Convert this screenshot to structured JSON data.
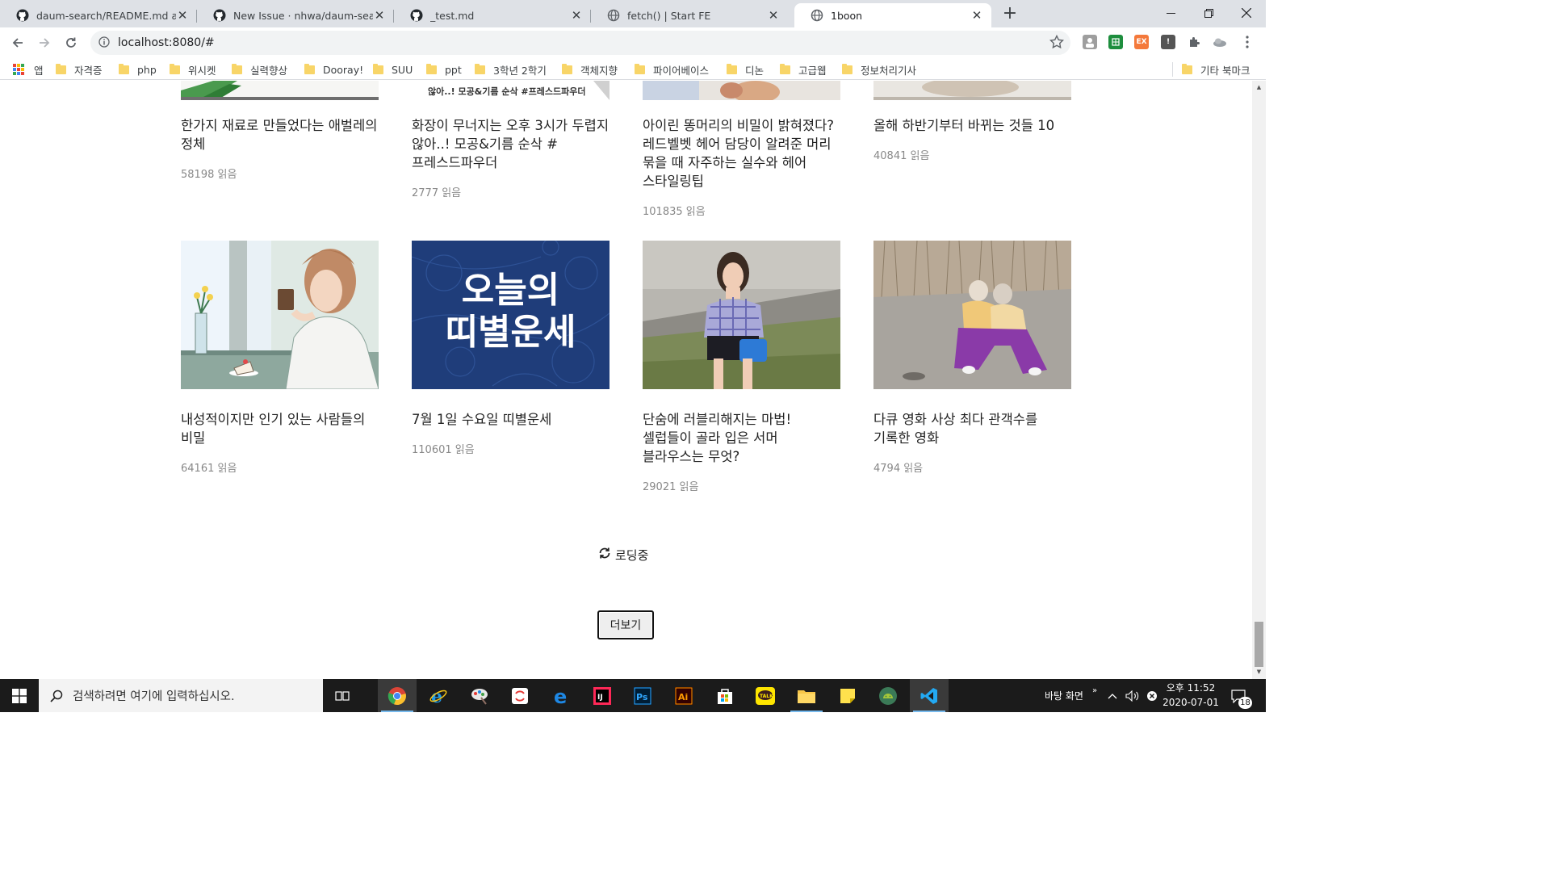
{
  "browser": {
    "tabs": [
      {
        "title": "daum-search/README.md at master · nhwa/daum-search",
        "icon": "github-icon",
        "active": false
      },
      {
        "title": "New Issue · nhwa/daum-search",
        "icon": "github-icon",
        "active": false
      },
      {
        "title": "_test.md",
        "icon": "github-icon",
        "active": false
      },
      {
        "title": "fetch() | Start FE",
        "icon": "globe-icon",
        "active": false
      },
      {
        "title": "1boon",
        "icon": "globe-icon",
        "active": true
      }
    ],
    "url": "localhost:8080/#",
    "bookmarks": [
      {
        "label": "앱",
        "type": "apps"
      },
      {
        "label": "자격증",
        "type": "folder"
      },
      {
        "label": "php",
        "type": "folder"
      },
      {
        "label": "위시켓",
        "type": "folder"
      },
      {
        "label": "실력향상",
        "type": "folder"
      },
      {
        "label": "Dooray!",
        "type": "folder"
      },
      {
        "label": "SUU",
        "type": "folder"
      },
      {
        "label": "ppt",
        "type": "folder"
      },
      {
        "label": "3학년 2학기",
        "type": "folder"
      },
      {
        "label": "객체지향",
        "type": "folder"
      },
      {
        "label": "파이어베이스",
        "type": "folder"
      },
      {
        "label": "디논",
        "type": "folder"
      },
      {
        "label": "고급웹",
        "type": "folder"
      },
      {
        "label": "정보처리기사",
        "type": "folder"
      }
    ],
    "other_bookmarks": "기타 북마크"
  },
  "page": {
    "top_row": [
      {
        "title": "한가지 재료로 만들었다는 애벌레의 정체",
        "reads": "58198 읽음",
        "thumb_text": ""
      },
      {
        "title": "화장이 무너지는 오후 3시가 두렵지 않아..! 모공&기름 순삭 #프레스드파우더",
        "reads": "2777 읽음",
        "thumb_text": "않아..! 모공&기름 순삭 #프레스드파우더"
      },
      {
        "title": "아이린 똥머리의 비밀이 밝혀졌다? 레드벨벳 헤어 담당이 알려준 머리 묶을 때 자주하는 실수와 헤어 스타일링팁",
        "reads": "101835 읽음",
        "thumb_text": ""
      },
      {
        "title": "올해 하반기부터 바뀌는 것들 10",
        "reads": "40841 읽음",
        "thumb_text": ""
      }
    ],
    "bottom_row": [
      {
        "title": "내성적이지만 인기 있는 사람들의 비밀",
        "reads": "64161 읽음"
      },
      {
        "title": "7월 1일 수요일 띠별운세",
        "reads": "110601 읽음",
        "thumb_line1": "오늘의",
        "thumb_line2": "띠별운세"
      },
      {
        "title": "단숨에 러블리해지는 마법! 셀럽들이 골라 입은 서머 블라우스는 무엇?",
        "reads": "29021 읽음"
      },
      {
        "title": "다큐 영화 사상 최다 관객수를 기록한 영화",
        "reads": "4794 읽음"
      }
    ],
    "loading_text": "로딩중",
    "more_button": "더보기"
  },
  "taskbar": {
    "search_placeholder": "검색하려면 여기에 입력하십시오.",
    "desktop_label": "바탕 화면",
    "time": "오후 11:52",
    "date": "2020-07-01",
    "notification_count": "18",
    "apps": [
      "task-view-icon",
      "chrome-icon",
      "ie-icon",
      "paint-icon",
      "sync-app-icon",
      "edge-icon",
      "intellij-icon",
      "photoshop-icon",
      "illustrator-icon",
      "store-icon",
      "kakaotalk-icon",
      "file-explorer-icon",
      "sticky-notes-icon",
      "android-icon",
      "vscode-icon"
    ]
  },
  "colors": {
    "tabstrip": "#dee1e6",
    "folder": "#f8d568",
    "fortune_bg": "#1f3d7a",
    "taskbar": "#1b1b1b",
    "reads_gray": "#888888"
  }
}
